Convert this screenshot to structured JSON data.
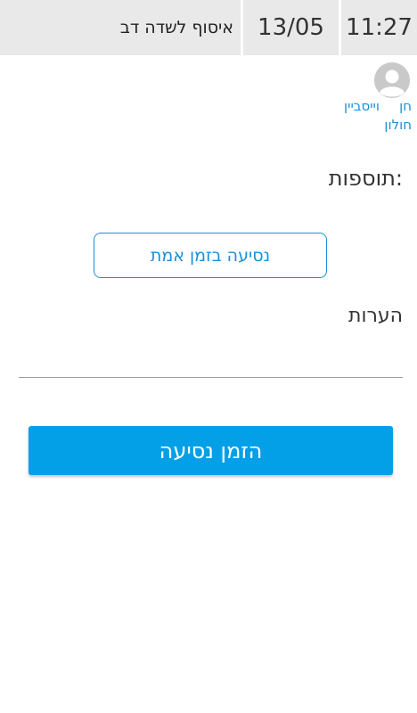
{
  "header": {
    "title": "איסוף לשדה דב",
    "date": "13/05",
    "time": "11:27"
  },
  "driver": {
    "first_name": "חן",
    "last_name": "וייסביין",
    "city": "חולון",
    "avatar_icon": "user-avatar-icon"
  },
  "extras": {
    "label": "תוספות:",
    "real_time_button": "נסיעה בזמן אמת"
  },
  "notes": {
    "label": "הערות",
    "value": "",
    "placeholder": ""
  },
  "order_button": {
    "label": "הזמן נסיעה"
  },
  "colors": {
    "accent": "#03a0e8",
    "link": "#1b8fd6",
    "header_bg": "#e9e9e9"
  }
}
